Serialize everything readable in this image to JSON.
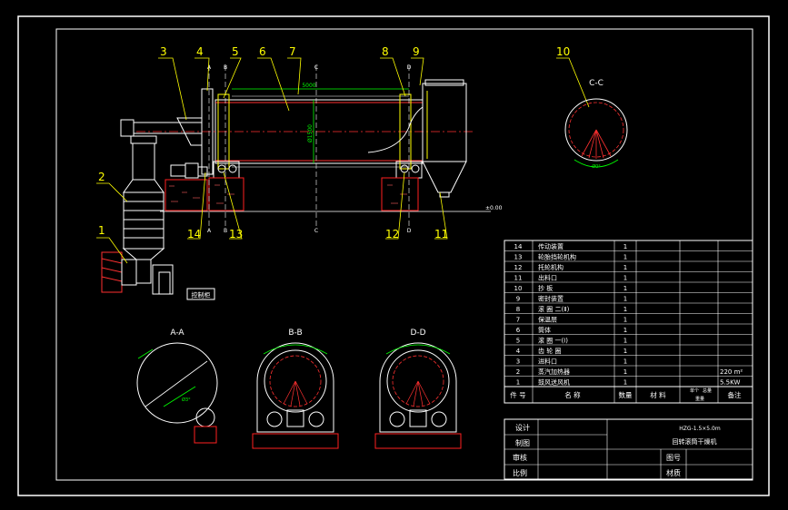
{
  "colors": {
    "background": "#000000",
    "border": "#ffffff",
    "leader": "#ffff00",
    "dimension": "#00ff00",
    "body": "#ffffff",
    "foundation": "#ff2020",
    "hatch": "#ff6060"
  },
  "balloons": [
    "1",
    "2",
    "3",
    "4",
    "5",
    "6",
    "7",
    "8",
    "9",
    "10",
    "11",
    "12",
    "13",
    "14"
  ],
  "section_marks": [
    "A",
    "B",
    "C",
    "D",
    "A",
    "B",
    "C",
    "D"
  ],
  "view_titles": {
    "a": "A-A",
    "b": "B-B",
    "d": "D-D",
    "c": "C-C"
  },
  "dims": {
    "length": "5000",
    "dia": "Ø1500",
    "ground": "±0.00",
    "cc_angle": "Ø0°",
    "aa_angle": "Ø3°"
  },
  "control_label": "控制柜",
  "parts_table": {
    "rows": [
      {
        "no": "14",
        "name": "传动装置",
        "qty": "1",
        "note": ""
      },
      {
        "no": "13",
        "name": "轮胎挡轮机构",
        "qty": "1",
        "note": ""
      },
      {
        "no": "12",
        "name": "托轮机构",
        "qty": "1",
        "note": ""
      },
      {
        "no": "11",
        "name": "出料口",
        "qty": "1",
        "note": ""
      },
      {
        "no": "10",
        "name": "抄    板",
        "qty": "1",
        "note": ""
      },
      {
        "no": "9",
        "name": "密封装置",
        "qty": "1",
        "note": ""
      },
      {
        "no": "8",
        "name": "滚 圈 二(Ⅱ)",
        "qty": "1",
        "note": ""
      },
      {
        "no": "7",
        "name": "保温层",
        "qty": "1",
        "note": ""
      },
      {
        "no": "6",
        "name": "筒体",
        "qty": "1",
        "note": ""
      },
      {
        "no": "5",
        "name": "滚 圈 一(Ⅰ)",
        "qty": "1",
        "note": ""
      },
      {
        "no": "4",
        "name": "齿 轮 圈",
        "qty": "1",
        "note": ""
      },
      {
        "no": "3",
        "name": "进料口",
        "qty": "1",
        "note": ""
      },
      {
        "no": "2",
        "name": "蒸汽加热器",
        "qty": "1",
        "note": "220 m²"
      },
      {
        "no": "1",
        "name": "鼓风送风机",
        "qty": "1",
        "note": "5.5KW"
      }
    ],
    "header": {
      "no": "件   号",
      "name": "名      称",
      "qty": "数量",
      "material": "材   料",
      "single": "单个",
      "total": "总量",
      "weight": "重量",
      "note": "备注"
    }
  },
  "title_block": {
    "design": "设计",
    "drawing": "制图",
    "review": "审核",
    "scale": "比例",
    "model": "HZG-1.5×5.0m",
    "product": "回转滚筒干燥机",
    "drawing_no": "图号",
    "material": "材质"
  }
}
